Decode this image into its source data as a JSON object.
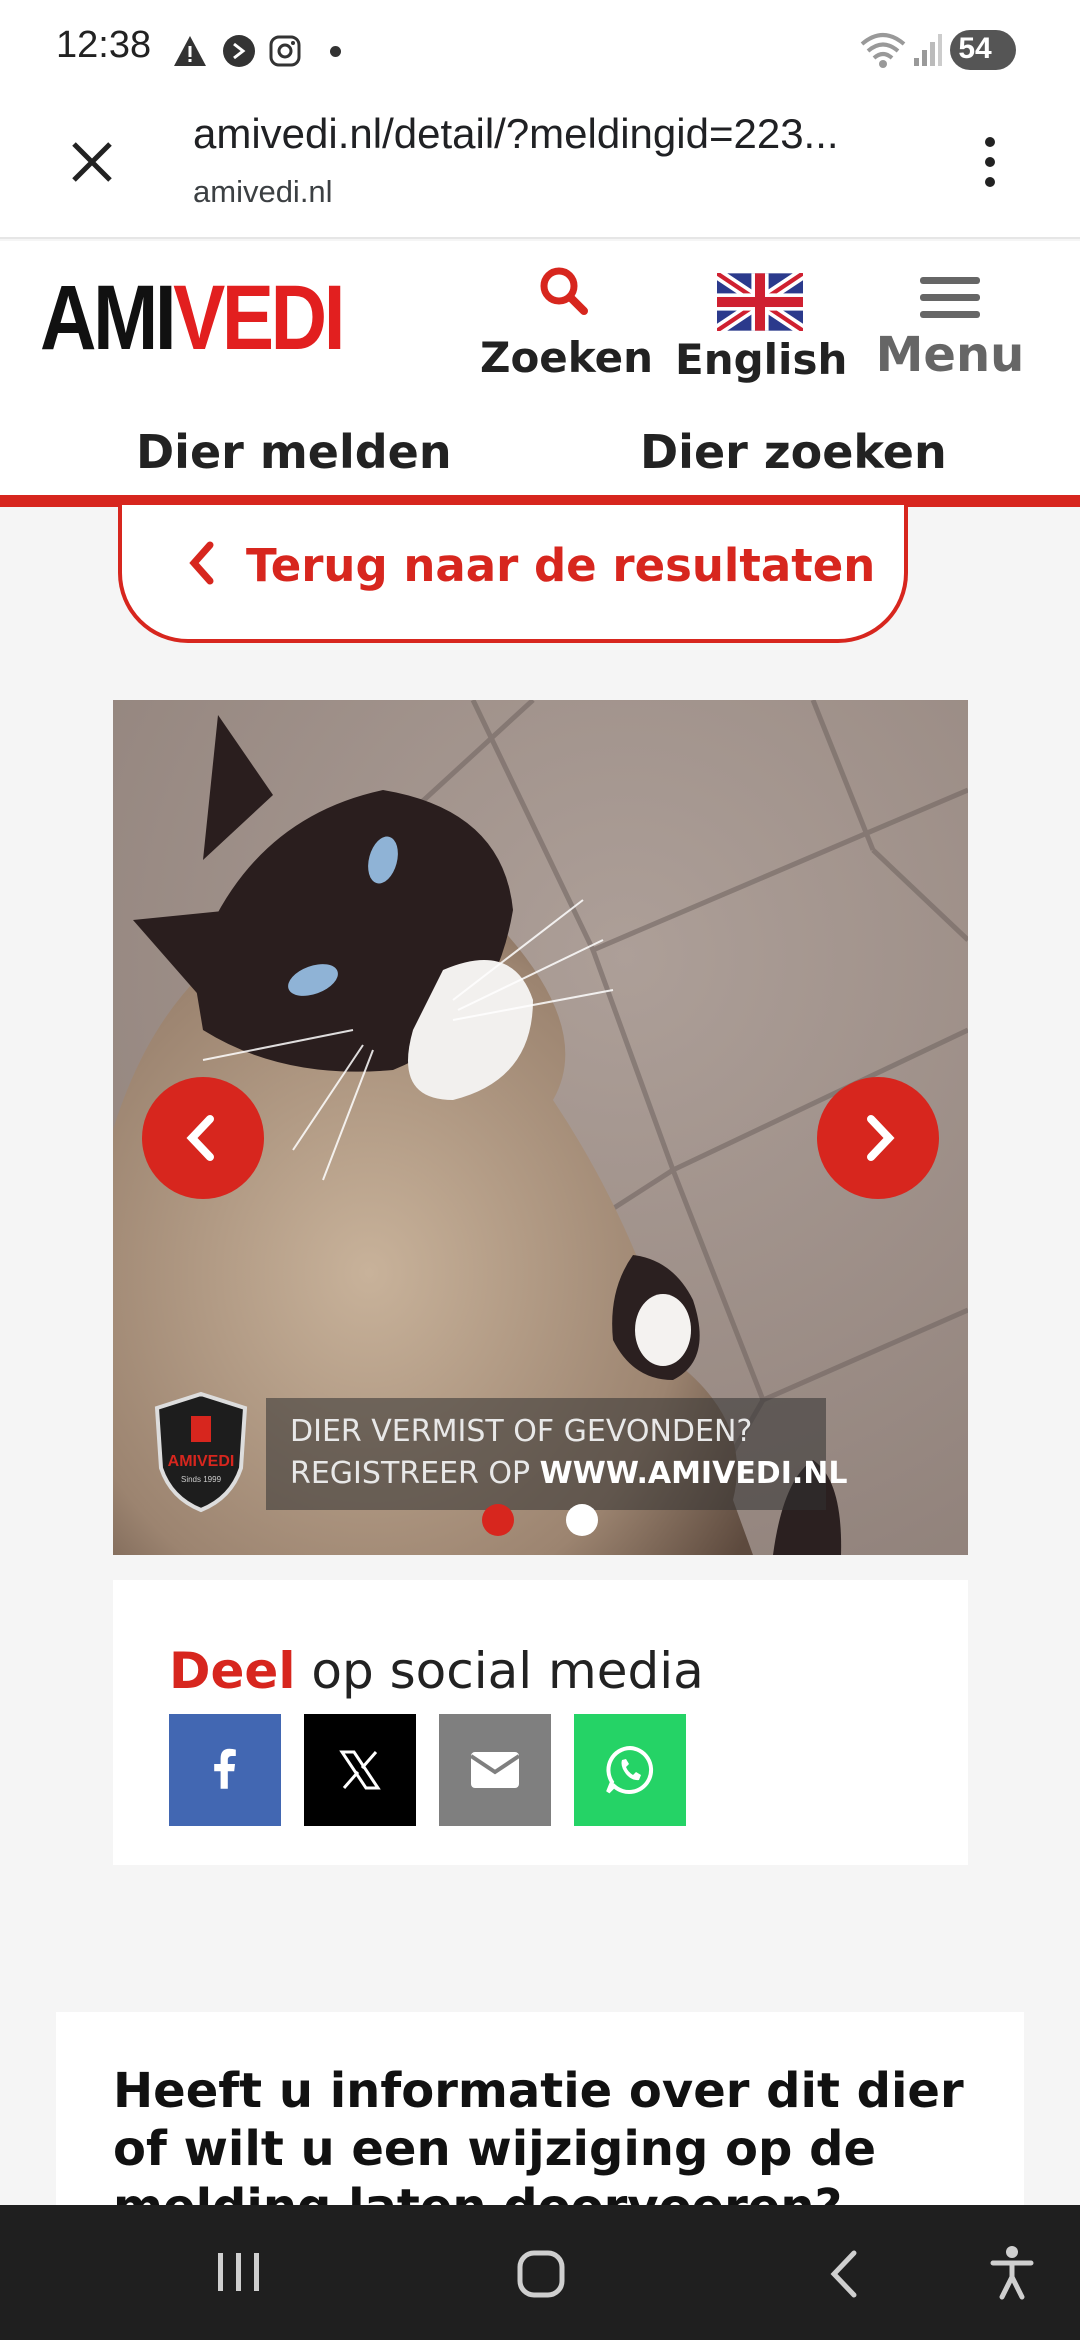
{
  "status_bar": {
    "time": "12:38",
    "battery": "54"
  },
  "browser": {
    "url": "amivedi.nl/detail/?meldingid=223...",
    "domain": "amivedi.nl"
  },
  "header": {
    "logo_part1": "AMI",
    "logo_part2": "VEDI",
    "search_label": "Zoeken",
    "language_label": "English",
    "menu_label": "Menu"
  },
  "nav": {
    "report_label": "Dier melden",
    "search_label": "Dier zoeken"
  },
  "back_button": {
    "label": "Terug naar de resultaten"
  },
  "photo": {
    "overlay_line1": "DIER VERMIST OF GEVONDEN?",
    "overlay_line2_prefix": "REGISTREER OP ",
    "overlay_line2_url": "WWW.AMIVEDI.NL",
    "badge_text": "AMIVEDI",
    "badge_sub": "Sinds 1999",
    "slides": 2,
    "active_slide": 1
  },
  "share": {
    "title_strong": "Deel",
    "title_rest": " op social media"
  },
  "info": {
    "heading": "Heeft u informatie over dit dier of wilt u een wijziging op de melding laten doorvoeren?"
  },
  "colors": {
    "brand_red": "#d7261e",
    "facebook": "#4267b2",
    "x": "#000000",
    "email": "#7f7f7f",
    "whatsapp": "#25d366"
  }
}
